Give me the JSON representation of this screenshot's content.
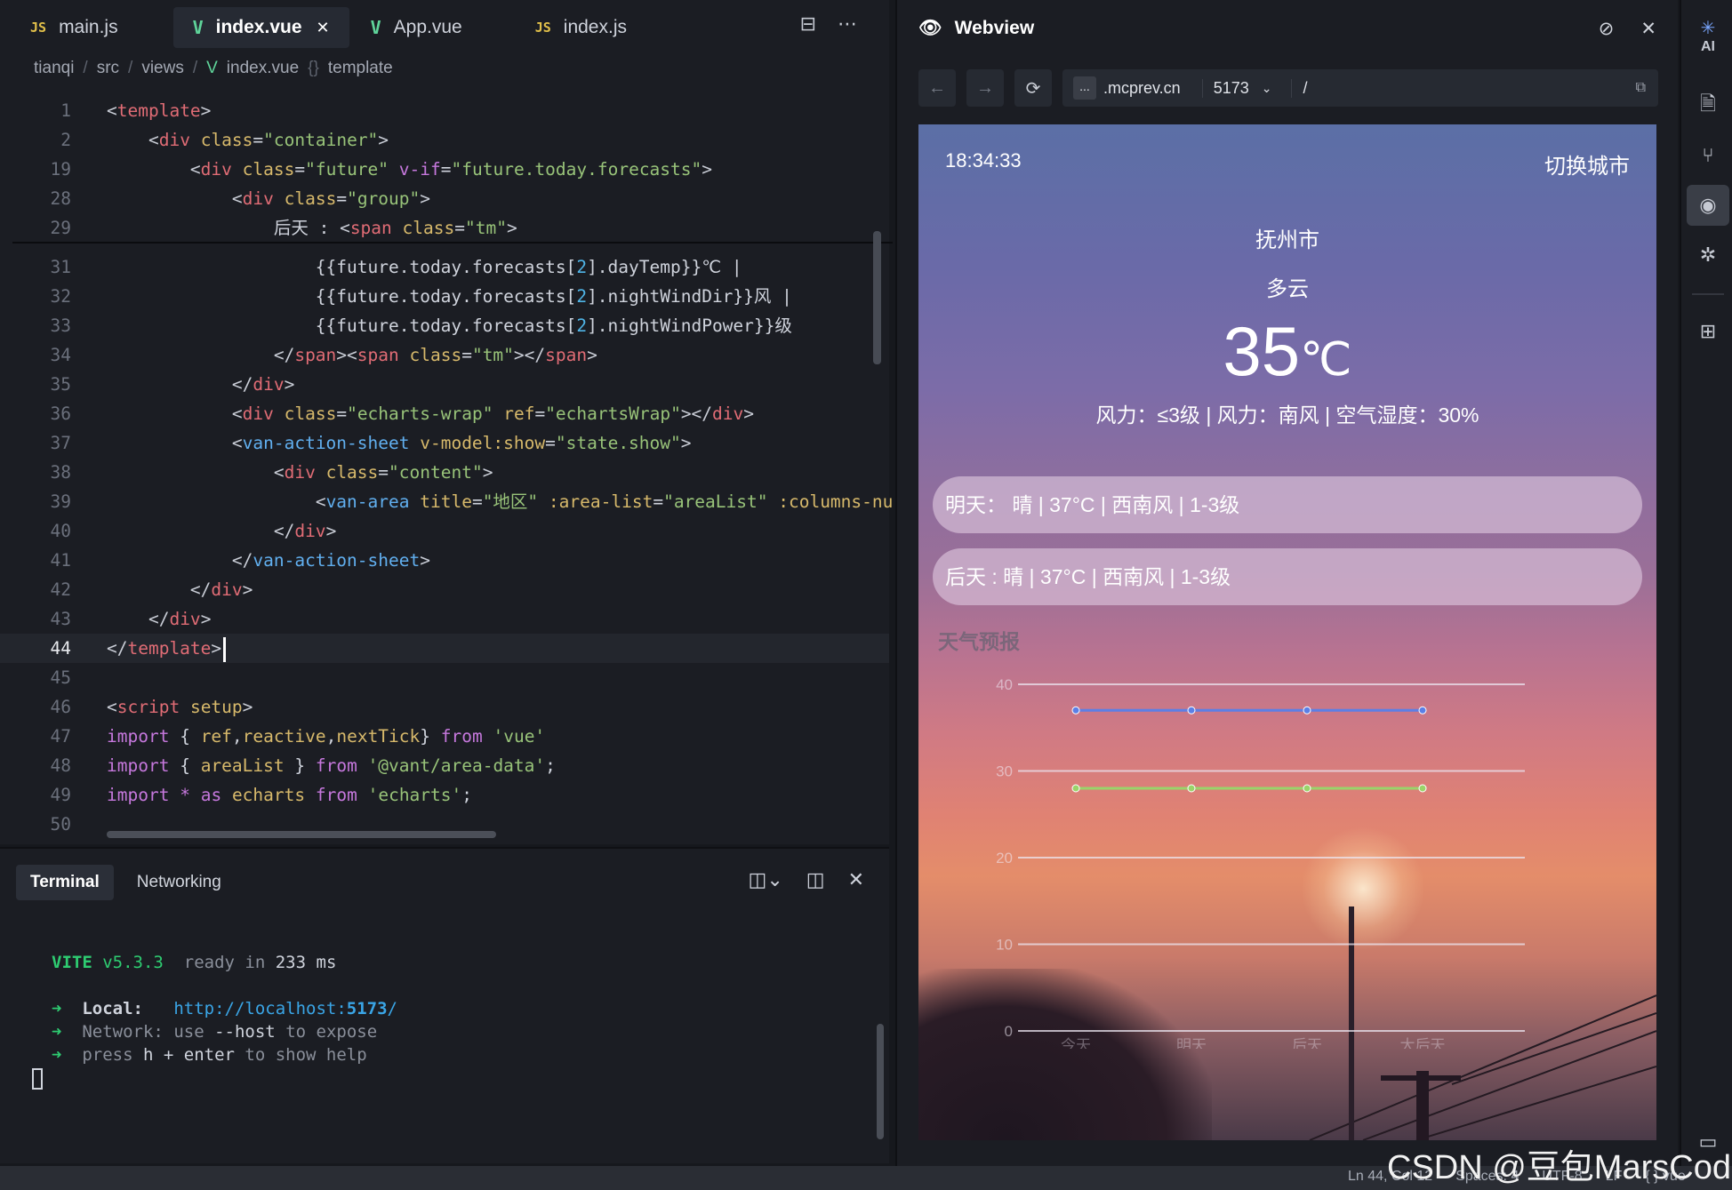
{
  "editor": {
    "tabs": [
      {
        "label": "main.js",
        "icon": "JS"
      },
      {
        "label": "index.vue",
        "icon": "V",
        "close": "✕"
      },
      {
        "label": "App.vue",
        "icon": "V"
      },
      {
        "label": "index.js",
        "icon": "JS"
      }
    ],
    "breadcrumb": [
      "tianqi",
      "src",
      "views",
      "index.vue",
      "template"
    ],
    "line_numbers": [
      "1",
      "2",
      "19",
      "28",
      "29",
      "31",
      "32",
      "33",
      "34",
      "35",
      "36",
      "37",
      "38",
      "39",
      "40",
      "41",
      "42",
      "43",
      "44",
      "45",
      "46",
      "47",
      "48",
      "49",
      "50"
    ],
    "current_line": "44"
  },
  "terminal": {
    "tabs": [
      "Terminal",
      "Networking"
    ],
    "vite": "VITE",
    "version": "v5.3.3",
    "ready": "ready in",
    "ms_value": "233",
    "ms_unit": "ms",
    "arrow": "➜",
    "local_label": "Local:",
    "local_url_a": "http://localhost:",
    "local_url_port": "5173",
    "local_url_b": "/",
    "network_label": "Network:",
    "network_use": "use",
    "network_flag": "--host",
    "network_rest": "to expose",
    "help_press": "press",
    "help_key": "h + enter",
    "help_rest": "to show help"
  },
  "webview": {
    "title": "Webview",
    "host": ".mcprev.cn",
    "dots": "...",
    "port": "5173",
    "path": "/",
    "app": {
      "time": "18:34:33",
      "switch_city": "切换城市",
      "city": "抚州市",
      "condition": "多云",
      "temp_value": "35",
      "temp_unit": "℃",
      "wind_line": "风力：≤3级 | 风力：南风 | 空气湿度：30%",
      "card_tomorrow": "明天： 晴 | 37°C | 西南风 | 1-3级",
      "card_after": "后天 : 晴 | 37°C | 西南风 | 1-3级",
      "forecast_title": "天气预报"
    }
  },
  "chart_data": {
    "type": "line",
    "categories": [
      "今天",
      "明天",
      "后天",
      "大后天"
    ],
    "series": [
      {
        "values": [
          37,
          37,
          37,
          37
        ],
        "color": "#5b7fe6"
      },
      {
        "values": [
          28,
          28,
          28,
          28
        ],
        "color": "#9ad46a"
      }
    ],
    "y_ticks": [
      0,
      10,
      20,
      30,
      40
    ],
    "ylim": [
      0,
      40
    ],
    "grid": true
  },
  "status": {
    "position": "Ln 44, Col 12",
    "spaces": "Spaces: 4",
    "encoding": "UTF-8",
    "eol": "LF",
    "lang": "{ } vue"
  },
  "watermark": "CSDN @豆包MarsCode"
}
